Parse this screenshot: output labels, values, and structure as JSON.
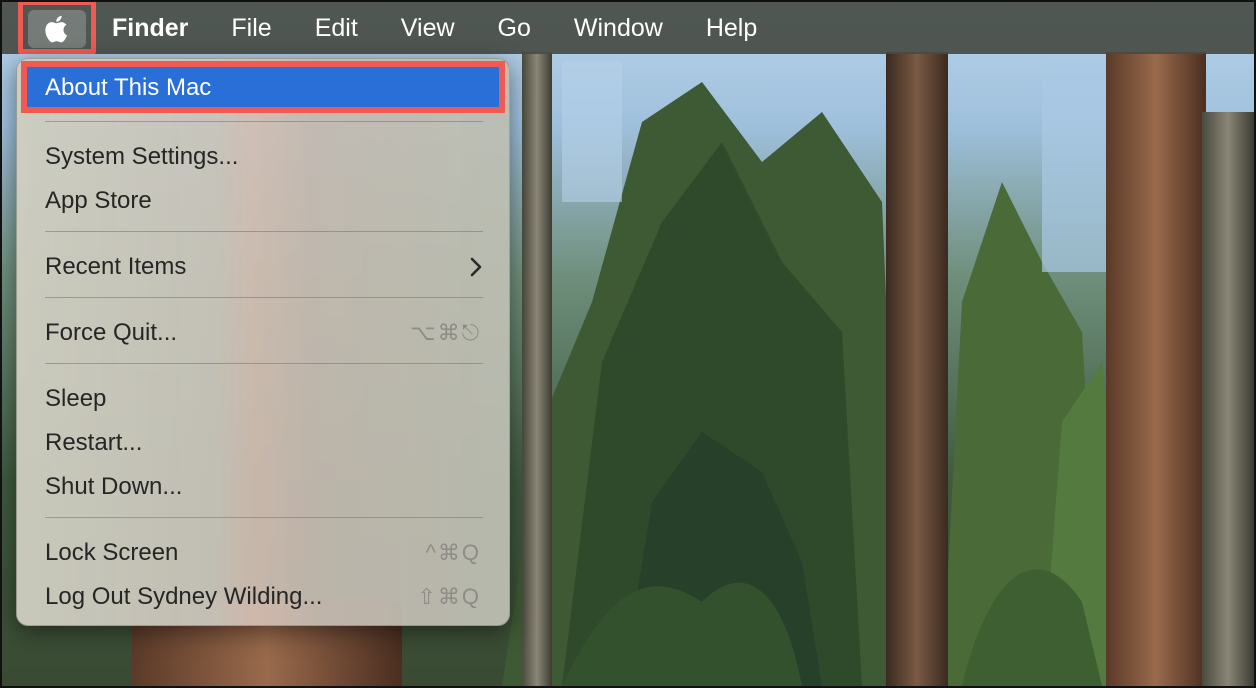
{
  "menubar": {
    "apple_icon": "apple-logo-icon",
    "items": [
      "Finder",
      "File",
      "Edit",
      "View",
      "Go",
      "Window",
      "Help"
    ]
  },
  "apple_menu": {
    "items": [
      {
        "label": "About This Mac",
        "highlighted": true
      },
      {
        "label": "System Settings..."
      },
      {
        "label": "App Store"
      },
      {
        "label": "Recent Items",
        "submenu_icon": "chevron-right-icon"
      },
      {
        "label": "Force Quit...",
        "shortcut": "⌥⌘⎋"
      },
      {
        "label": "Sleep"
      },
      {
        "label": "Restart..."
      },
      {
        "label": "Shut Down..."
      },
      {
        "label": "Lock Screen",
        "shortcut": "^⌘Q"
      },
      {
        "label": "Log Out Sydney Wilding...",
        "shortcut": "⇧⌘Q"
      }
    ]
  },
  "colors": {
    "highlight_blue": "#2a6fd8",
    "annotation_red": "#ef5a52",
    "menubar_bg": "#464c44"
  }
}
